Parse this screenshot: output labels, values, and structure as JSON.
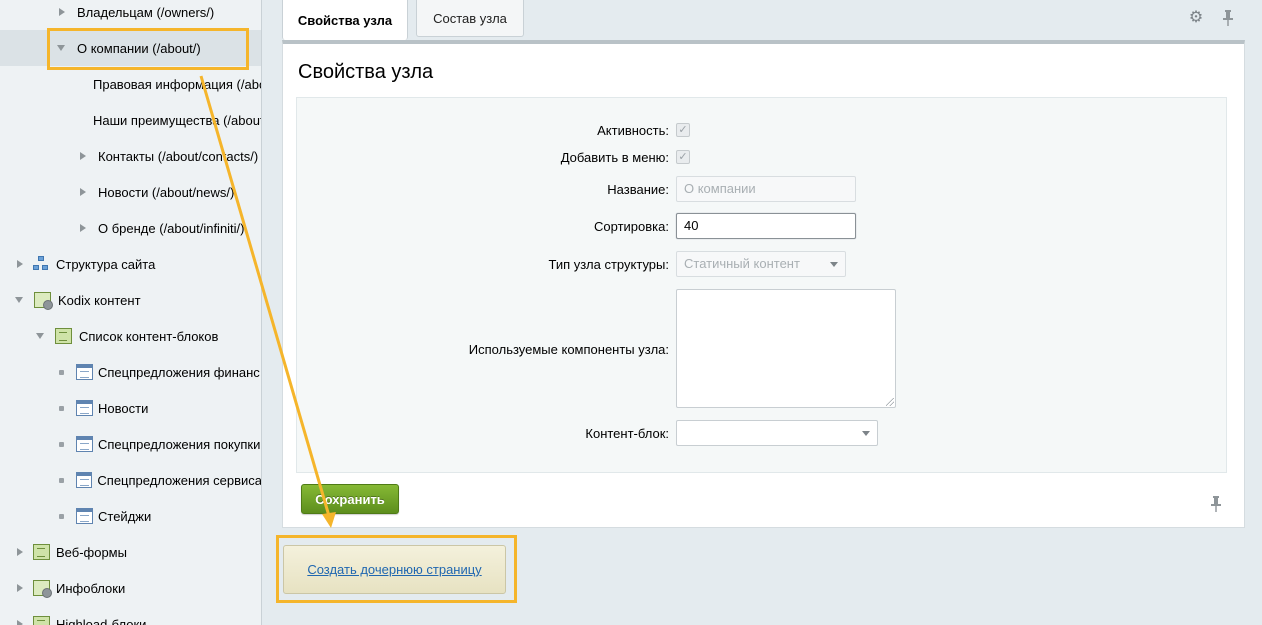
{
  "sidebar": {
    "items": [
      {
        "label": "Владельцам (/owners/)",
        "marker": "arrow-right",
        "icon": null
      },
      {
        "label": "О компании (/about/)",
        "marker": "arrow-down",
        "icon": null,
        "selected": true
      },
      {
        "label": "Правовая информация (/about/",
        "marker": "dot",
        "icon": null
      },
      {
        "label": "Наши преимущества (/about/",
        "marker": "dot",
        "icon": null
      },
      {
        "label": "Контакты (/about/contacts/)",
        "marker": "arrow-right",
        "icon": null
      },
      {
        "label": "Новости (/about/news/)",
        "marker": "arrow-right",
        "icon": null
      },
      {
        "label": "О бренде (/about/infiniti/)",
        "marker": "arrow-right",
        "icon": null
      },
      {
        "label": "Структура сайта",
        "marker": "arrow-right",
        "icon": "site-structure-icon"
      },
      {
        "label": "Kodix контент",
        "marker": "arrow-down",
        "icon": "kodix-content-icon"
      },
      {
        "label": "Список контент-блоков",
        "marker": "arrow-down",
        "icon": "content-list-icon"
      },
      {
        "label": "Спецпредложения финанс",
        "marker": "dot",
        "icon": "page-icon"
      },
      {
        "label": "Новости",
        "marker": "dot",
        "icon": "page-icon"
      },
      {
        "label": "Спецпредложения покупки",
        "marker": "dot",
        "icon": "page-icon"
      },
      {
        "label": "Спецпредложения сервиса",
        "marker": "dot",
        "icon": "page-icon"
      },
      {
        "label": "Стейджи",
        "marker": "dot",
        "icon": "page-icon"
      },
      {
        "label": "Веб-формы",
        "marker": "arrow-right",
        "icon": "web-forms-icon"
      },
      {
        "label": "Инфоблоки",
        "marker": "arrow-right",
        "icon": "infoblocks-icon"
      },
      {
        "label": "Highload-блоки",
        "marker": "arrow-right",
        "icon": "highload-icon"
      }
    ]
  },
  "tabs": [
    {
      "label": "Свойства узла",
      "active": true
    },
    {
      "label": "Состав узла",
      "active": false
    }
  ],
  "toolbar": {
    "settings_icon": "gear-icon",
    "pin_icon": "pin-icon"
  },
  "panel": {
    "title": "Свойства узла",
    "fields": {
      "active": {
        "label": "Активность:",
        "checked": true
      },
      "add_to_menu": {
        "label": "Добавить в меню:",
        "checked": true
      },
      "name": {
        "label": "Название:",
        "placeholder": "О компании",
        "value": ""
      },
      "sort": {
        "label": "Сортировка:",
        "value": "40"
      },
      "node_type": {
        "label": "Тип узла структуры:",
        "value": "Статичный контент"
      },
      "components": {
        "label": "Используемые компоненты узла:",
        "value": ""
      },
      "content_block": {
        "label": "Контент-блок:",
        "value": ""
      }
    },
    "save_label": "Сохранить"
  },
  "create_child": {
    "label": "Создать дочернюю страницу"
  },
  "colors": {
    "highlight": "#f5b52b",
    "save_green": "#6a9e26",
    "link": "#2067b0"
  }
}
